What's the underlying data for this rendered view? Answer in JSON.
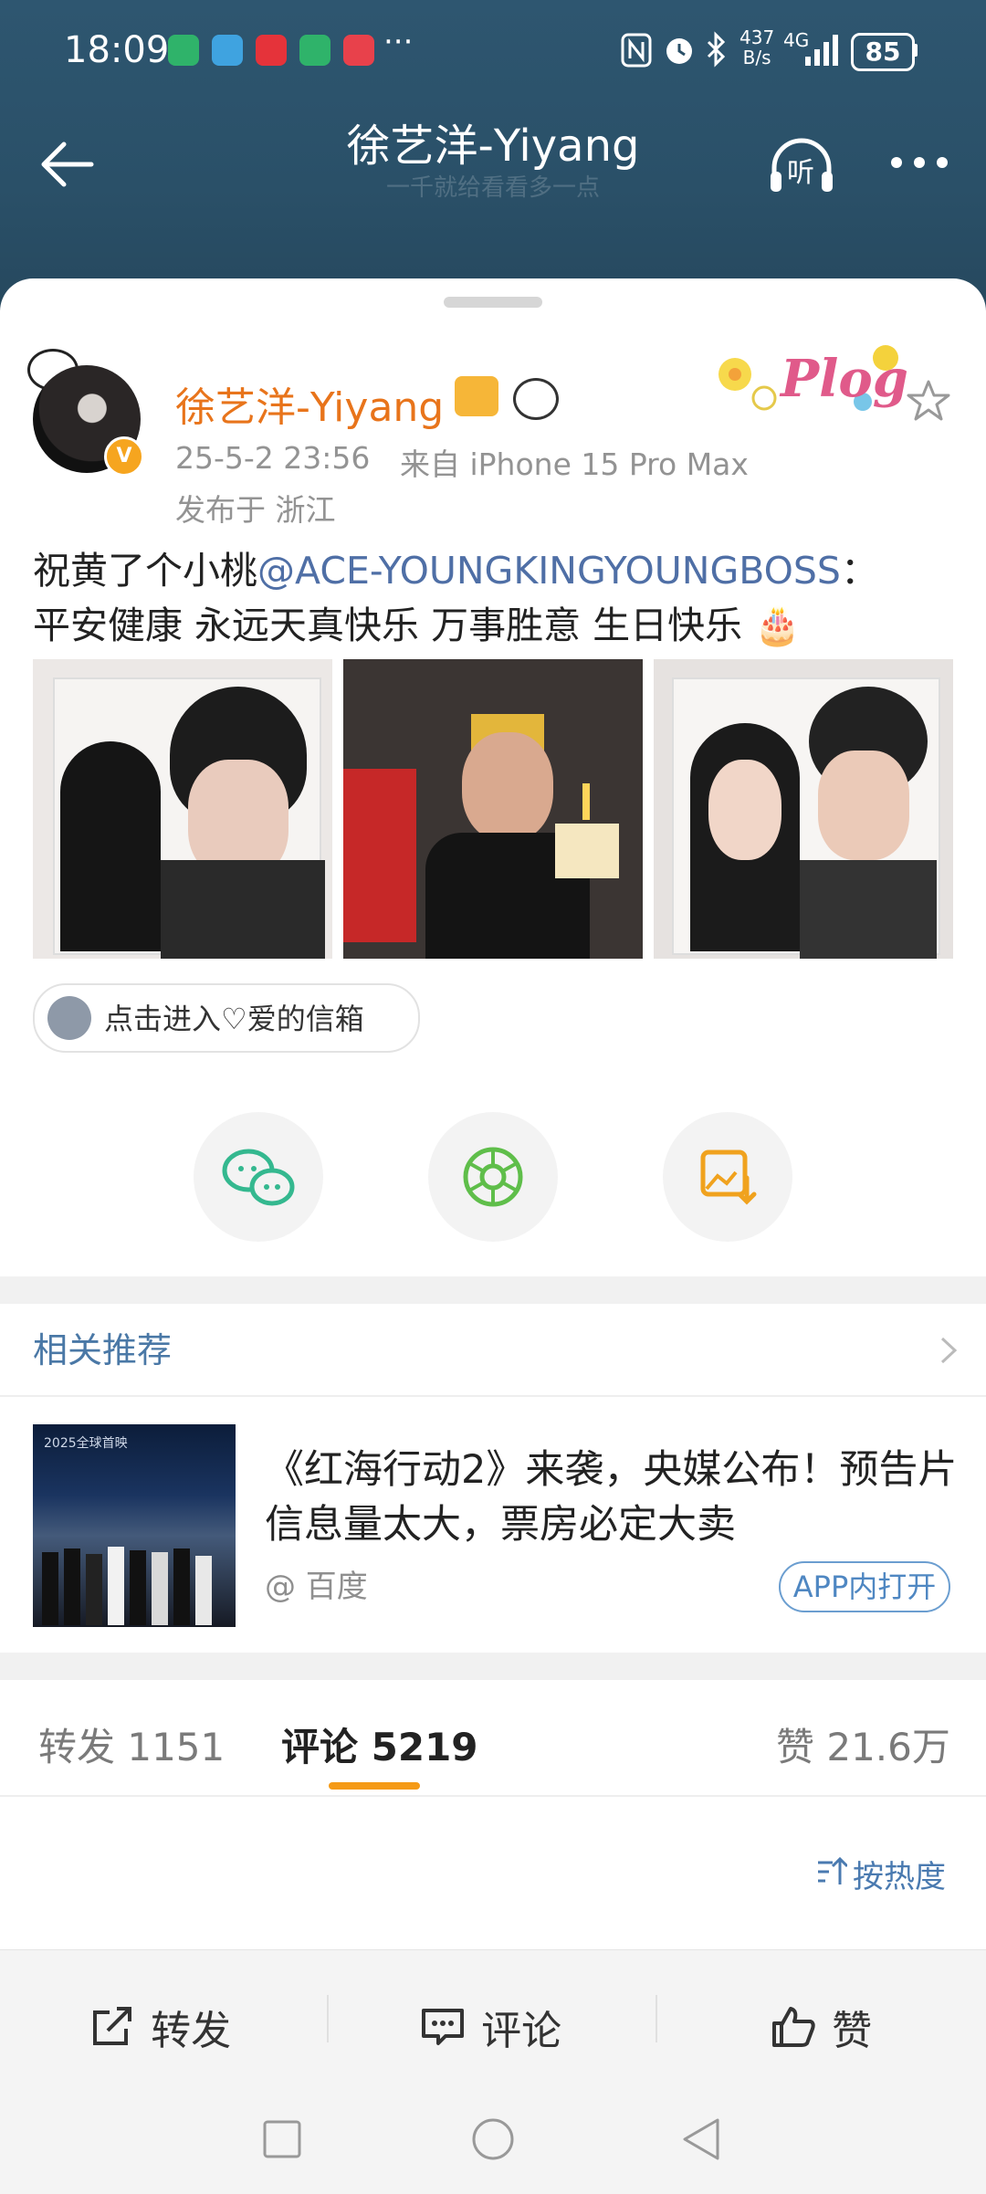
{
  "status_bar": {
    "time": "18:09",
    "more_icons": "···",
    "net_speed_top": "437",
    "net_speed_bottom": "B/s",
    "network": "4G",
    "battery": "85"
  },
  "header": {
    "title": "徐艺洋-Yiyang",
    "subtitle": "一千就给看看多一点",
    "listen_label": "听"
  },
  "post": {
    "user_name": "徐艺洋-Yiyang",
    "timestamp": "25-5-2 23:56",
    "source": "来自 iPhone 15 Pro Max",
    "location": "发布于 浙江",
    "sticker_text": "Plog",
    "text_part1": "祝黄了个小桃",
    "mention": "@ACE-YOUNGKINGYOUNGBOSS",
    "text_part2": "：",
    "text_line2": "平安健康 永远天真快乐 万事胜意 生日快乐",
    "cake_emoji": "🎂",
    "link_chip": "点击进入♡爱的信箱"
  },
  "share": {
    "icons": [
      "wechat-icon",
      "moments-icon",
      "save-image-icon"
    ]
  },
  "related": {
    "title": "相关推荐",
    "news_title": "《红海行动2》来袭，央媒公布！预告片信息量太大，票房必定大卖",
    "news_source": "@ 百度",
    "news_button": "APP内打开",
    "thumb_text": "2025全球首映"
  },
  "tabs": {
    "repost": "转发 1151",
    "comments": "评论 5219",
    "likes": "赞 21.6万",
    "active": "comments"
  },
  "sort_label": "按热度",
  "bottom_actions": {
    "repost": "转发",
    "comment": "评论",
    "like": "赞"
  },
  "colors": {
    "header_bg": "#2a5068",
    "username": "#e8741b",
    "mention": "#4f6fa6",
    "accent_orange": "#f59a15",
    "link_blue": "#4a7ab0"
  }
}
